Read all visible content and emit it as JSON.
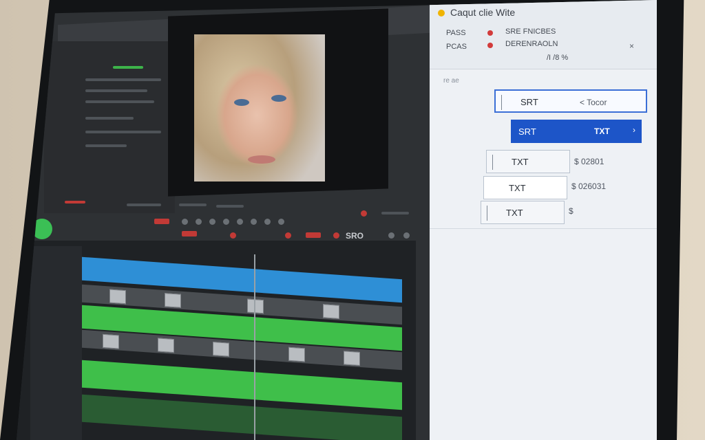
{
  "panel": {
    "title": "Caqut clie Wite",
    "row1_label": "PASS",
    "row1_text": "SRE FNICBES",
    "row2_label": "PCAS",
    "row2_text": "DERENRAOLN",
    "sub_text": "/I /8 %",
    "small_text": "re ae",
    "close": "×",
    "fields": [
      {
        "label": "SRT",
        "right": "< Tocor",
        "state": "active"
      },
      {
        "label": "SRT",
        "right": "TXT",
        "state": "selected"
      },
      {
        "label": "TXT",
        "right": "$  02801",
        "state": "normal"
      },
      {
        "label": "TXT",
        "right": "$  026031",
        "state": "normal"
      },
      {
        "label": "TXT",
        "right": "$",
        "state": "normal"
      }
    ]
  },
  "timeline": {
    "label": "SRO"
  },
  "colors": {
    "accent_blue": "#1d55c8",
    "track_blue": "#2e8fd6",
    "track_green": "#3fbf4a",
    "record_red": "#c23a36"
  }
}
